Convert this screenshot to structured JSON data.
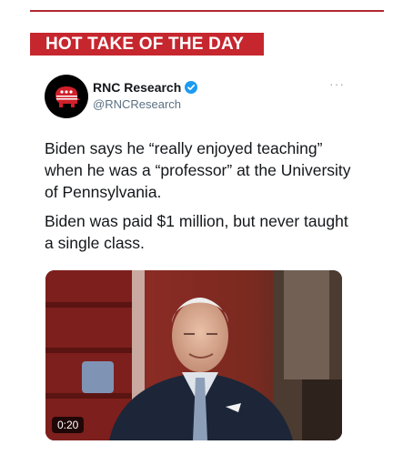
{
  "banner": {
    "text": "HOT TAKE OF THE DAY"
  },
  "tweet": {
    "author_name": "RNC Research",
    "author_handle": "@RNCResearch",
    "more_label": "···",
    "paragraph_1": "Biden says he “really enjoyed teaching” when he was a “professor” at the University of Pennsylvania.",
    "paragraph_2": "Biden was paid $1 million, but never taught a single class.",
    "video_duration": "0:20"
  },
  "colors": {
    "banner": "#c6262e",
    "verified": "#1d9bf0",
    "handle": "#5b7083"
  },
  "icons": {
    "avatar": "elephant-logo-icon",
    "verified": "verified-badge-icon",
    "more": "more-options-icon"
  }
}
